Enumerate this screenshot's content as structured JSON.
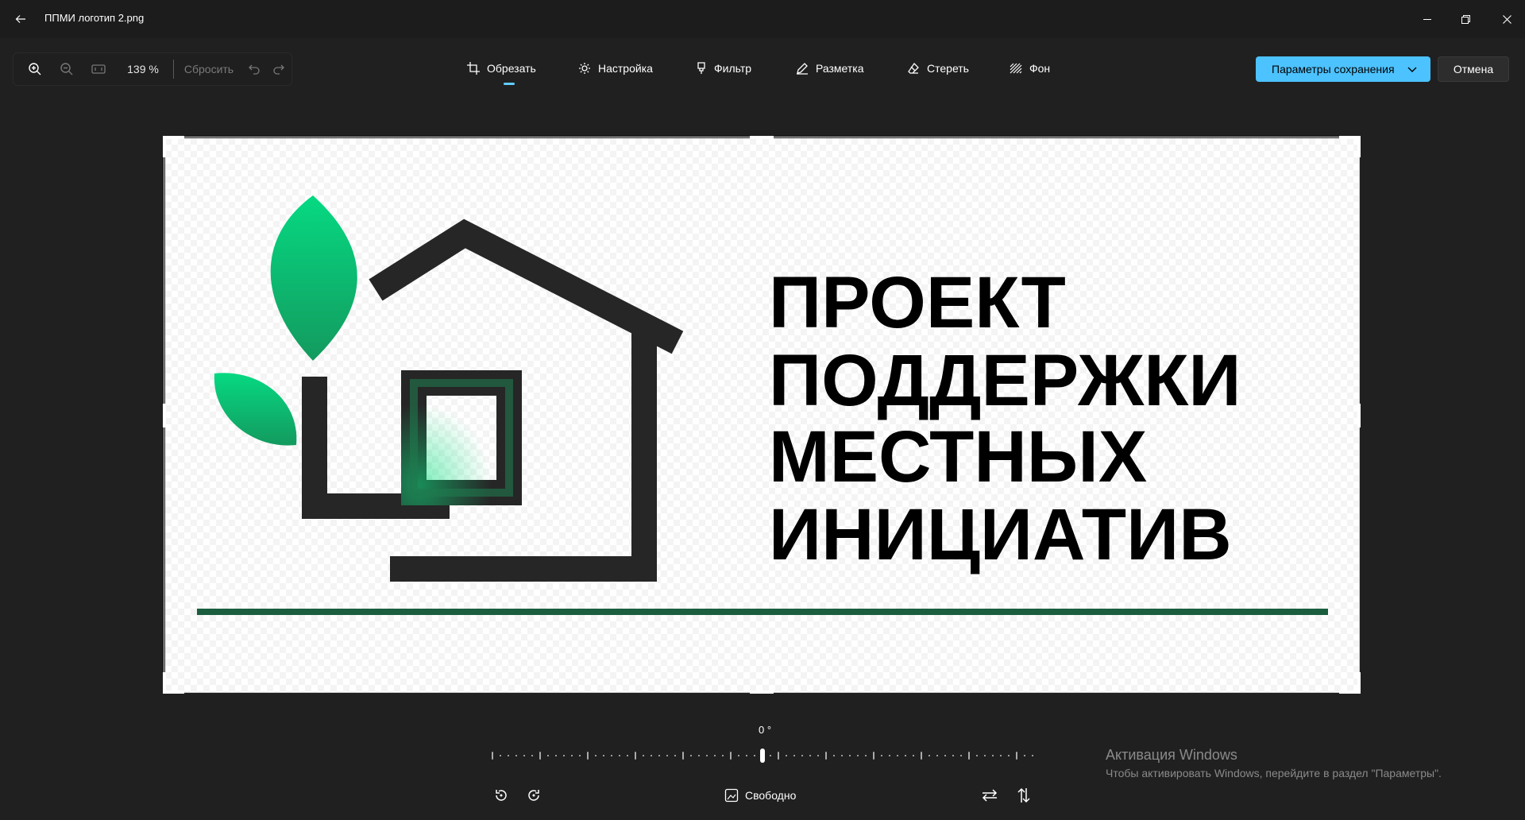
{
  "window": {
    "title": "ППМИ логотип 2.png"
  },
  "zoom": {
    "value": "139 %",
    "reset_label": "Сбросить"
  },
  "tools": [
    {
      "label": "Обрезать",
      "icon": "crop-icon",
      "active": true
    },
    {
      "label": "Настройка",
      "icon": "brightness-icon"
    },
    {
      "label": "Фильтр",
      "icon": "filter-brush-icon"
    },
    {
      "label": "Разметка",
      "icon": "pen-icon"
    },
    {
      "label": "Стереть",
      "icon": "eraser-icon"
    },
    {
      "label": "Фон",
      "icon": "background-icon"
    }
  ],
  "actions": {
    "save_label": "Параметры сохранения",
    "cancel_label": "Отмена"
  },
  "colors": {
    "accent": "#4cc2ff",
    "leaf_green": "#0fd47c",
    "dark_green": "#1b5e3f",
    "logo_dark": "#262626"
  },
  "image": {
    "logo_text": [
      "ПРОЕКТ",
      "ПОДДЕРЖКИ",
      "МЕСТНЫХ",
      "ИНИЦИАТИВ"
    ]
  },
  "rotation": {
    "angle": "0 °"
  },
  "aspect": {
    "label": "Свободно"
  },
  "watermark": {
    "title": "Активация Windows",
    "subtitle": "Чтобы активировать Windows, перейдите в раздел \"Параметры\"."
  }
}
